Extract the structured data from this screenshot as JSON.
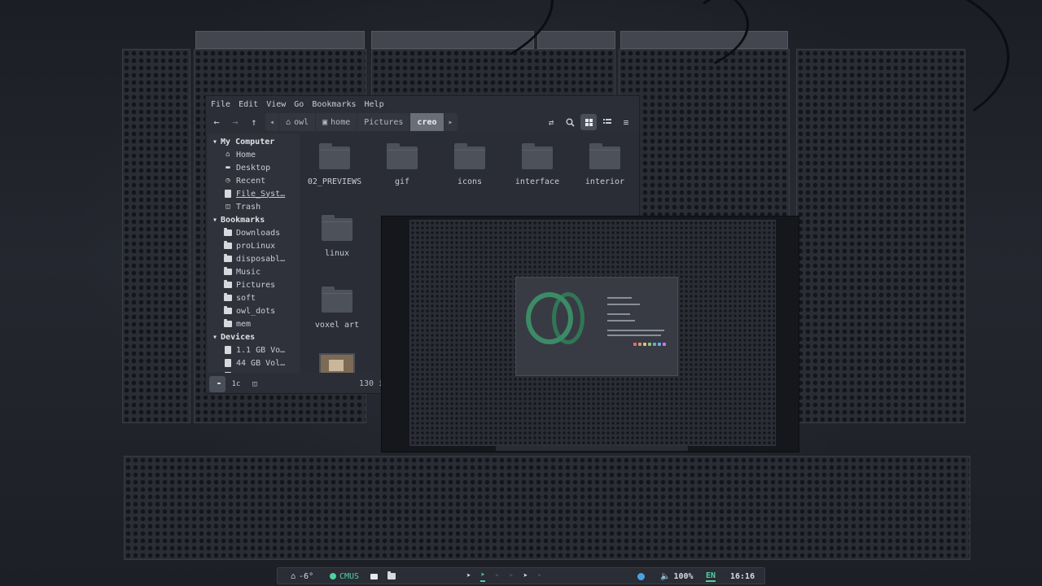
{
  "menu": [
    "File",
    "Edit",
    "View",
    "Go",
    "Bookmarks",
    "Help"
  ],
  "breadcrumbs": [
    "owl",
    "home",
    "Pictures",
    "creo"
  ],
  "sidebar": {
    "my_computer": {
      "title": "My Computer",
      "items": [
        {
          "label": "Home",
          "icon": "home-icon"
        },
        {
          "label": "Desktop",
          "icon": "desktop-icon"
        },
        {
          "label": "Recent",
          "icon": "recent-icon"
        },
        {
          "label": "File_Syst…",
          "icon": "drive-icon"
        },
        {
          "label": "Trash",
          "icon": "trash-icon"
        }
      ]
    },
    "bookmarks": {
      "title": "Bookmarks",
      "items": [
        "Downloads",
        "proLinux",
        "disposabl…",
        "Music",
        "Pictures",
        "soft",
        "owl_dots",
        "mem"
      ]
    },
    "devices": {
      "title": "Devices",
      "items": [
        "1.1 GB Vo…",
        "44 GB Vol…"
      ]
    }
  },
  "files": [
    "02_PREVIEWS",
    "gif",
    "icons",
    "interface",
    "interior",
    "linux",
    "voxel art"
  ],
  "status": {
    "count": "130 i"
  },
  "bar": {
    "weather": "-6°",
    "player": "CMUS",
    "volume": "100%",
    "lang": "EN",
    "time": "16:16"
  },
  "colors": {
    "accent": "#4fd1a0",
    "panel": "#2b2e36",
    "active_crumb": "#6a6e78"
  }
}
